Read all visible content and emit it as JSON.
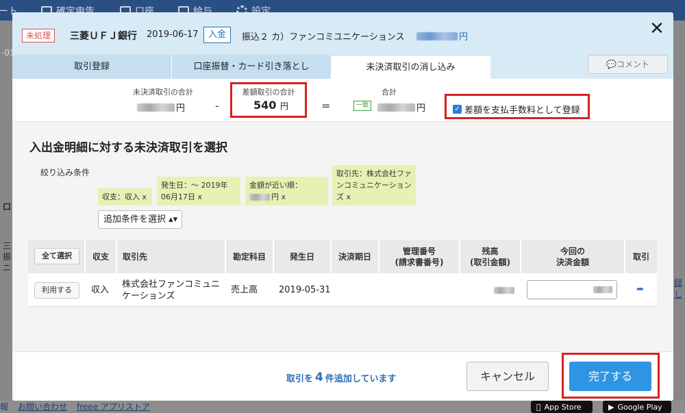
{
  "background": {
    "nav_items": [
      "ート",
      "確定申告",
      "口座",
      "給与",
      "設定"
    ],
    "footer_links": [
      "報",
      "お問い合わせ",
      "freee アプリストア"
    ],
    "store_badges": [
      "App Store",
      "Google Play"
    ],
    "edge_texts": [
      "-01",
      "口",
      "三",
      "振",
      "ニ",
      "録し"
    ]
  },
  "header": {
    "status_badge": "未処理",
    "bank": "三菱ＵＦＪ銀行",
    "date": "2019-06-17",
    "type_badge": "入金",
    "description": "振込２ カ）ファンコミユニケーションス",
    "amount_unit": "円"
  },
  "tabs": [
    {
      "label": "取引登録",
      "active": false
    },
    {
      "label": "口座振替・カード引き落とし",
      "active": false
    },
    {
      "label": "未決済取引の消し込み",
      "active": true
    }
  ],
  "comment_button": "💬コメント",
  "summary": {
    "unsettled_label": "未決済取引の合計",
    "unsettled_unit": "円",
    "minus": "-",
    "diff_label": "差額取引の合計",
    "diff_value": "540",
    "diff_unit": "円",
    "equals": "=",
    "total_label": "合計",
    "match_badge": "一致",
    "total_unit": "円",
    "checkbox_label": "差額を支払手数料として登録",
    "checkbox_checked": true
  },
  "section": {
    "title": "入出金明細に対する未決済取引を選択",
    "filter_label": "絞り込み条件",
    "chips": [
      "収支：収入 x",
      "発生日：～ 2019年06月17日 x",
      "金額が近い順：",
      "円 x",
      "取引先：株式会社ファンコミュニケーションズ x"
    ],
    "add_filter": "追加条件を選択 ▴▾"
  },
  "table": {
    "select_all": "全て選択",
    "headers": [
      "収支",
      "取引先",
      "勘定科目",
      "発生日",
      "決済期日",
      "管理番号\n(請求書番号)",
      "残高\n(取引金額)",
      "今回の\n決済金額",
      "取引"
    ],
    "rows": [
      {
        "use_button": "利用する",
        "type": "収入",
        "partner": "株式会社ファンコミュニケーションズ",
        "account": "売上高",
        "date": "2019-05-31",
        "due": "",
        "ref": ""
      }
    ]
  },
  "footer": {
    "msg_prefix": "取引を",
    "msg_count": "4",
    "msg_suffix": "件追加しています",
    "cancel": "キャンセル",
    "done": "完了する"
  },
  "colors": {
    "accent": "#2f95e3",
    "highlight": "#d62020",
    "header_bg": "#d8eaf5",
    "chip_bg": "#e6f1b4"
  }
}
